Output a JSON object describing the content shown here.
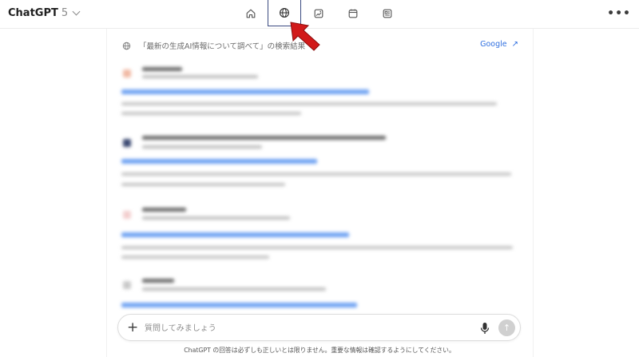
{
  "header": {
    "model_name": "ChatGPT",
    "model_version": "5",
    "more_label": "•••",
    "tabs": [
      {
        "name": "home",
        "icon": "home-icon"
      },
      {
        "name": "web-search",
        "icon": "globe-icon",
        "active": true
      },
      {
        "name": "images",
        "icon": "image-icon"
      },
      {
        "name": "calendar",
        "icon": "calendar-icon"
      },
      {
        "name": "news",
        "icon": "newspaper-icon"
      }
    ]
  },
  "results": {
    "title": "「最新の生成AI情報について調べて」の検索結果",
    "google_label": "Google",
    "google_arrow": "↗"
  },
  "composer": {
    "placeholder": "質問してみましょう",
    "plus": "+",
    "send": "↑"
  },
  "footer": {
    "disclaimer": "ChatGPT の回答は必ずしも正しいとは限りません。重要な情報は確認するようにしてください。"
  },
  "colors": {
    "accent": "#2f6fe0",
    "active_tab_border": "#3b4a80",
    "annotation_arrow": "#d11a1a"
  }
}
